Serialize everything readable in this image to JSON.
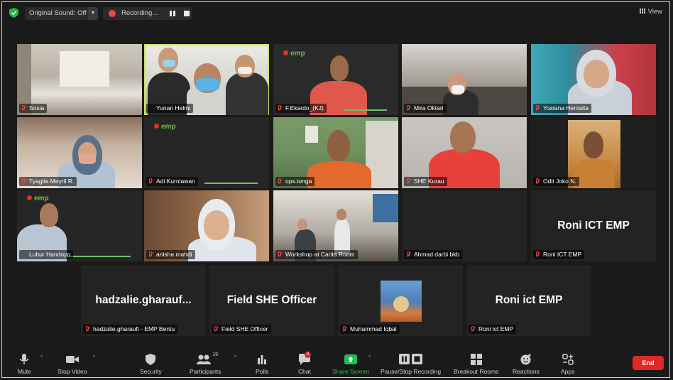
{
  "topbar": {
    "original_sound": "Original Sound: Off",
    "recording": "Recording...",
    "view": "View"
  },
  "tiles": [
    {
      "name": "Sosia",
      "big": ""
    },
    {
      "name": "Yunan Helmi",
      "big": ""
    },
    {
      "name": "F.Ekardo_(KJ)",
      "big": ""
    },
    {
      "name": "Mira Oktari",
      "big": ""
    },
    {
      "name": "Yosiana Herosita",
      "big": ""
    },
    {
      "name": "Tyagita Meyril R.",
      "big": ""
    },
    {
      "name": "Adi Kurniawan",
      "big": ""
    },
    {
      "name": "ops.tonga",
      "big": ""
    },
    {
      "name": "SHE Kurau",
      "big": ""
    },
    {
      "name": "Odit Joko N.",
      "big": ""
    },
    {
      "name": "Luhur Handoyo",
      "big": ""
    },
    {
      "name": "anisha mahdi",
      "big": ""
    },
    {
      "name": "Workshop at Carita Room",
      "big": ""
    },
    {
      "name": "Ahmad darbi bkb",
      "big": ""
    },
    {
      "name": "Roni ICT EMP",
      "big": "Roni ICT EMP"
    },
    {
      "name": "hadzalie.gharaufi - EMP Bentu",
      "big": "hadzalie.gharauf..."
    },
    {
      "name": "Field SHE Officer",
      "big": "Field SHE Officer"
    },
    {
      "name": "Muhammad Iqbal",
      "big": ""
    },
    {
      "name": "Roni ict EMP",
      "big": "Roni ict EMP"
    }
  ],
  "logo_text": "emp",
  "toolbar": {
    "mute": "Mute",
    "stop_video": "Stop Video",
    "security": "Security",
    "participants": "Participants",
    "participants_count": "19",
    "polls": "Polls",
    "chat": "Chat",
    "chat_badge": "3",
    "share_screen": "Share Screen",
    "pause_stop_recording": "Pause/Stop Recording",
    "breakout_rooms": "Breakout Rooms",
    "reactions": "Reactions",
    "apps": "Apps",
    "end": "End"
  },
  "colors": {
    "active_speaker_border": "#c8e26a",
    "end_button": "#e02828",
    "share_screen": "#1fbf53",
    "muted_icon": "#e5484d"
  }
}
